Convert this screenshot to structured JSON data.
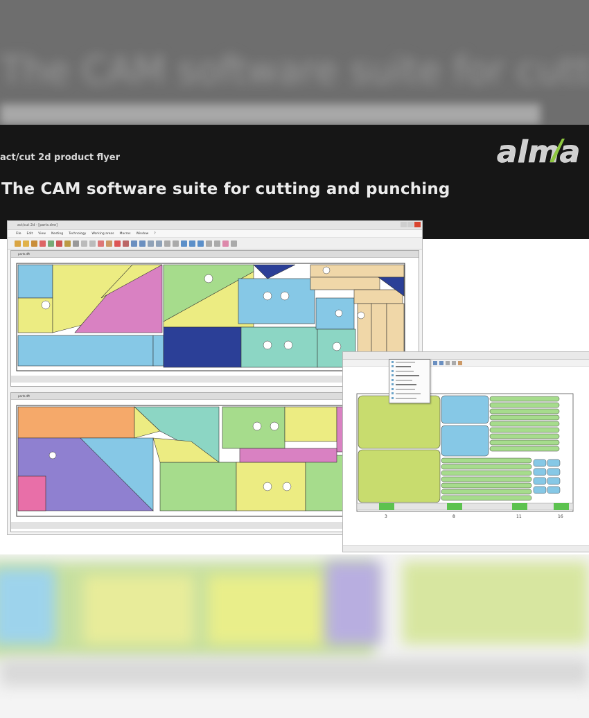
{
  "background_blur_text": "The CAM software suite for cutting and punching",
  "header": {
    "flyer_label": "act/cut 2d product flyer",
    "headline": "The CAM software suite for cutting and punching",
    "logo_text": "alma"
  },
  "main_window": {
    "title": "act/cut 2d - [parts.drw]",
    "menu": [
      "File",
      "Edit",
      "View",
      "Nesting",
      "Technology",
      "Working areas",
      "Macros",
      "Window",
      "?"
    ],
    "doc1_title": "parts.dft",
    "doc2_title": "parts.dft"
  },
  "second_window": {
    "ticks": [
      "3",
      "8",
      "11",
      "16"
    ]
  },
  "colors": {
    "header_bg": "#161616",
    "accent_green": "#8dc63f",
    "part_yellow": "#ecec82",
    "part_blue": "#86c8e6",
    "part_green": "#a6dc8c",
    "part_pink": "#d981c2",
    "part_teal": "#8cd6c4",
    "part_navy": "#2b3f97",
    "part_tan": "#f0d7a8",
    "part_lime": "#c8dc6e",
    "part_purple": "#8f80d0",
    "part_orange": "#f5a96a"
  }
}
